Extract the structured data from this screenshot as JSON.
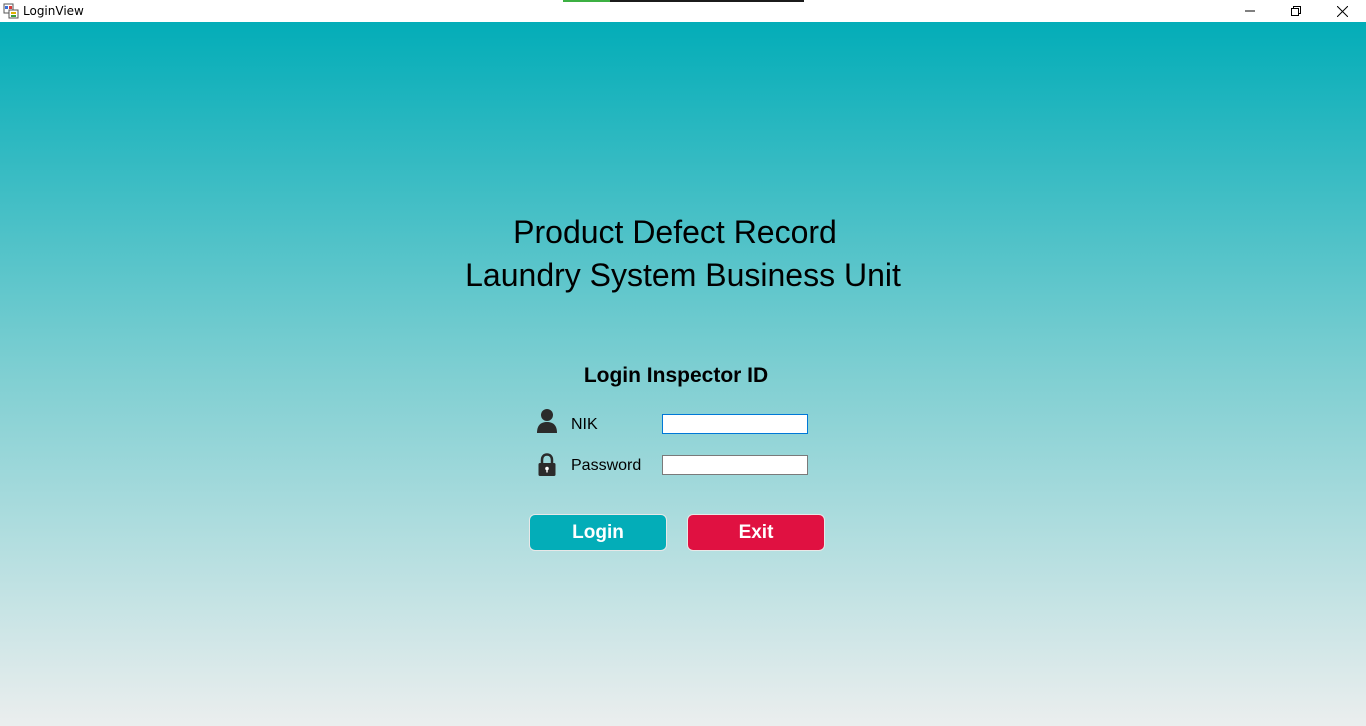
{
  "window": {
    "title": "LoginView",
    "icons": {
      "app": "app-window-icon",
      "minimize": "minimize-icon",
      "maximize": "restore-icon",
      "close": "close-icon"
    }
  },
  "app": {
    "title_line1": "Product Defect Record",
    "title_line2": "Laundry System Business Unit"
  },
  "login": {
    "heading": "Login Inspector ID",
    "nik_label": "NIK",
    "nik_value": "",
    "password_label": "Password",
    "password_value": "",
    "login_button": "Login",
    "exit_button": "Exit"
  },
  "colors": {
    "gradient_top": "#03adb8",
    "gradient_bottom": "#ebeeee",
    "login_button": "#03adb8",
    "exit_button": "#e01141",
    "icon": "#2b2b2b"
  }
}
